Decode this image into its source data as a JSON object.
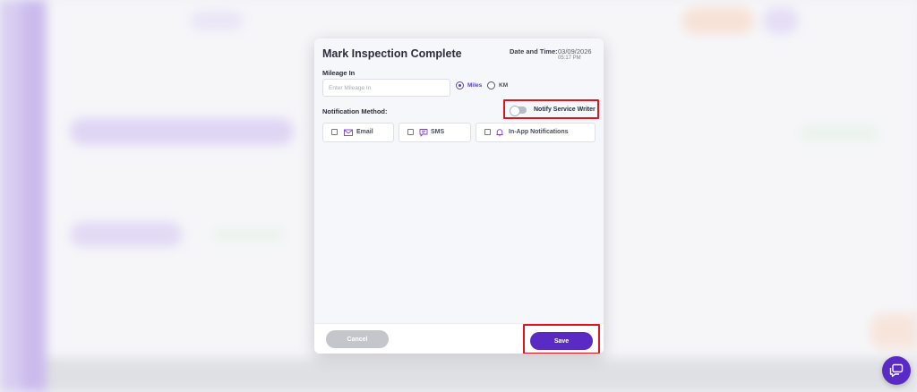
{
  "modal": {
    "title": "Mark Inspection Complete",
    "date_time_label": "Date and Time:",
    "date": "03/09/2026",
    "time": "05:17 PM",
    "mileage_label": "Mileage In",
    "mileage_value": "",
    "mileage_placeholder": "Enter Mileage In",
    "units": [
      {
        "label": "Miles",
        "selected": true
      },
      {
        "label": "KM",
        "selected": false
      }
    ],
    "notification_label": "Notification Method:",
    "notify_service_writer": {
      "label": "Notify Service Writer",
      "enabled": false
    },
    "methods": [
      {
        "label": "Email",
        "icon": "email-icon",
        "checked": false
      },
      {
        "label": "SMS",
        "icon": "sms-icon",
        "checked": false
      },
      {
        "label": "In-App Notifications",
        "icon": "bell-icon",
        "checked": false
      }
    ],
    "cancel_label": "Cancel",
    "save_label": "Save"
  },
  "colors": {
    "primary": "#5a2bc4",
    "highlight": "#e0141f",
    "cancel": "#c4c6cb"
  },
  "chat": {
    "icon": "chat-icon"
  }
}
